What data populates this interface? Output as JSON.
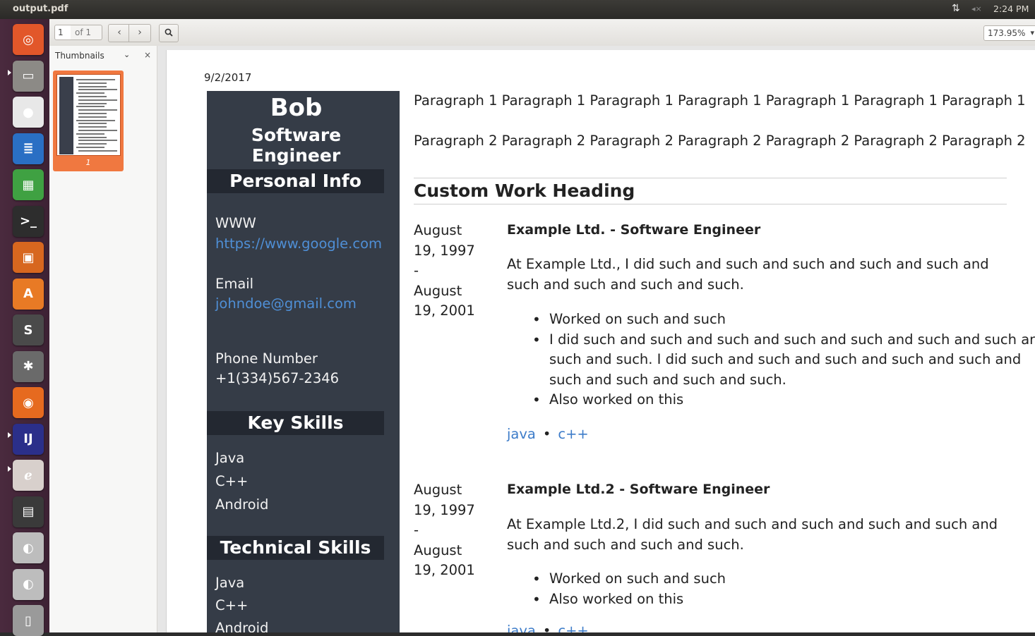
{
  "window": {
    "title": "output.pdf"
  },
  "system": {
    "time": "2:24 PM",
    "network_icon": "network-arrows-icon",
    "volume_icon": "volume-muted-icon"
  },
  "toolbar": {
    "page_number": "1",
    "page_of": "of 1",
    "zoom": "173.95%"
  },
  "sidebar": {
    "title": "Thumbnails",
    "thumb_page_label": "1"
  },
  "launcher": [
    {
      "name": "ubuntu-dash-icon",
      "color": "#e2572a"
    },
    {
      "name": "files-icon",
      "color": "#8c8a86"
    },
    {
      "name": "chrome-icon",
      "color": "#e8e8e8"
    },
    {
      "name": "writer-icon",
      "color": "#2a6fc4"
    },
    {
      "name": "calc-icon",
      "color": "#3fa142"
    },
    {
      "name": "terminal-icon",
      "color": "#2d2d2d"
    },
    {
      "name": "impress-icon",
      "color": "#d7671f"
    },
    {
      "name": "software-center-icon",
      "color": "#e87a25"
    },
    {
      "name": "sublime-icon",
      "color": "#4a4a4a"
    },
    {
      "name": "settings-icon",
      "color": "#6a6a6a"
    },
    {
      "name": "firefox-icon",
      "color": "#e66a1f"
    },
    {
      "name": "intellij-icon",
      "color": "#2b2f8a"
    },
    {
      "name": "document-viewer-icon",
      "color": "#d8d0cc"
    },
    {
      "name": "save-disk-icon",
      "color": "#3a3a3a"
    },
    {
      "name": "dvd-icon",
      "color": "#bdbdbd"
    },
    {
      "name": "dvd-icon-2",
      "color": "#bdbdbd"
    },
    {
      "name": "trash-icon",
      "color": "#9a9a9a"
    }
  ],
  "document": {
    "date": "9/2/2017",
    "name": "Bob",
    "role": "Software Engineer",
    "personal_header": "Personal Info",
    "www_label": "WWW",
    "www_value": "https://www.google.com",
    "email_label": "Email",
    "email_value": "johndoe@gmail.com",
    "phone_label": "Phone Number",
    "phone_value": "+1(334)567-2346",
    "key_skills_header": "Key Skills",
    "key_skills": [
      "Java",
      "C++",
      "Android"
    ],
    "tech_skills_header": "Technical Skills",
    "tech_skills": [
      "Java",
      "C++",
      "Android"
    ],
    "paragraph1": "Paragraph 1 Paragraph 1 Paragraph 1 Paragraph 1 Paragraph 1 Paragraph 1 Paragraph 1",
    "paragraph2": "Paragraph 2 Paragraph 2 Paragraph 2 Paragraph 2 Paragraph 2 Paragraph 2 Paragraph 2",
    "work_heading": "Custom Work Heading",
    "jobs": [
      {
        "date_lines": [
          "August",
          "19, 1997",
          "-",
          "August",
          "19, 2001"
        ],
        "title": "Example Ltd. - Software Engineer",
        "desc": "At Example Ltd., I did such and such and such and such and such and such and such and such and such.",
        "bullets": [
          "Worked on such and such",
          "I did such and such and such and such and such and such and such and such and such. I did such and such and such and such and such and such and such and such and such.",
          "Also worked on this"
        ],
        "tags": [
          "java",
          "c++"
        ]
      },
      {
        "date_lines": [
          "August",
          "19, 1997",
          "-",
          "August",
          "19, 2001"
        ],
        "title": "Example Ltd.2 - Software Engineer",
        "desc": "At Example Ltd.2, I did such and such and such and such and such and such and such and such and such.",
        "bullets": [
          "Worked on such and such",
          "Also worked on this"
        ],
        "tags": [
          "java",
          "c++"
        ]
      }
    ]
  }
}
